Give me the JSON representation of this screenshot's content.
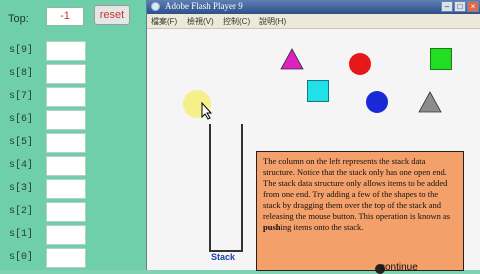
{
  "left_panel": {
    "top_label": "Top:",
    "top_value": "-1",
    "reset_label": "reset",
    "slots": [
      "s[9]",
      "s[8]",
      "s[7]",
      "s[6]",
      "s[5]",
      "s[4]",
      "s[3]",
      "s[2]",
      "s[1]",
      "s[0]"
    ]
  },
  "flash": {
    "title": "Adobe Flash Player 9",
    "menu": [
      "檔案(F)",
      "檢視(V)",
      "控制(C)",
      "說明(H)"
    ],
    "stack_label": "Stack",
    "info_part1": "The column on the left represents the stack data structure.  Notice that the stack only has one open end.  The stack data structure only allows items to be added from one end.  Try adding a few of the shapes to the stack by dragging them over the top of the stack and releasing the mouse button.  This operation is known as ",
    "info_bold": "push",
    "info_part2": "ing items onto the stack.",
    "continue_label": "continue"
  },
  "colors": {
    "panel": "#6fcfaa",
    "triangle_magenta": "#e020c0",
    "circle_red": "#e81818",
    "square_green": "#22dd22",
    "square_cyan": "#22e0e8",
    "circle_blue": "#1a28d8",
    "triangle_gray": "#8c8c8c",
    "circle_yellow": "#f5f08a",
    "info_box": "#f4a06a"
  }
}
